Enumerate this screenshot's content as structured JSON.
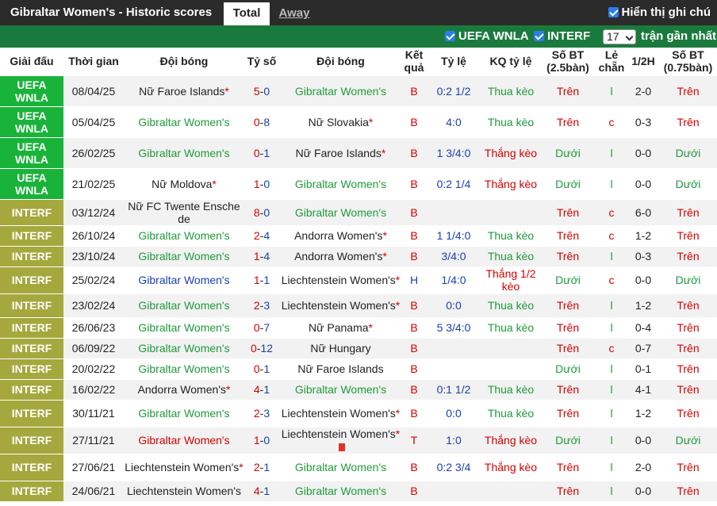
{
  "header": {
    "title": "Gibraltar Women's - Historic scores",
    "tabs": [
      "Total",
      "Away"
    ],
    "show_notes_label": "Hiển thị ghi chú"
  },
  "filters": {
    "uefa_label": "UEFA WNLA",
    "interf_label": "INTERF",
    "recent_count": "17",
    "recent_label": "trận gần nhất"
  },
  "columns": [
    "Giải đấu",
    "Thời gian",
    "Đội bóng",
    "Tỷ số",
    "Đội bóng",
    "Kết quả",
    "Tỷ lệ",
    "KQ tỷ lệ",
    "Số BT (2.5bàn)",
    "Lẻ chẵn",
    "1/2H",
    "Số BT (0.75bàn)"
  ],
  "colors": {
    "uefa": "#19b33a",
    "interf": "#a5a83c",
    "header_bg": "#2b2b2b",
    "filter_bg": "#1a7a3d"
  },
  "rows": [
    {
      "league": "UEFA WNLA",
      "date": "08/04/25",
      "home": "Nữ Faroe Islands",
      "home_star": "*",
      "home_color": "",
      "score_h": "5",
      "score_a": "0",
      "away": "Gibraltar Women's",
      "away_star": "",
      "away_color": "green",
      "result": "B",
      "odds": "0:2 1/2",
      "odds_res": "Thua kèo",
      "bt25": "Trên",
      "le": "l",
      "h1": "2-0",
      "bt075": "Trên"
    },
    {
      "league": "UEFA WNLA",
      "date": "05/04/25",
      "home": "Gibraltar Women's",
      "home_star": "",
      "home_color": "green",
      "score_h": "0",
      "score_a": "8",
      "away": "Nữ Slovakia",
      "away_star": "*",
      "away_color": "",
      "result": "B",
      "odds": "4:0",
      "odds_res": "Thua kèo",
      "bt25": "Trên",
      "le": "c",
      "h1": "0-3",
      "bt075": "Trên"
    },
    {
      "league": "UEFA WNLA",
      "date": "26/02/25",
      "home": "Gibraltar Women's",
      "home_star": "",
      "home_color": "green",
      "score_h": "0",
      "score_a": "1",
      "away": "Nữ Faroe Islands",
      "away_star": "*",
      "away_color": "",
      "result": "B",
      "odds": "1 3/4:0",
      "odds_res": "Thắng kèo",
      "bt25": "Dưới",
      "le": "l",
      "h1": "0-0",
      "bt075": "Dưới"
    },
    {
      "league": "UEFA WNLA",
      "date": "21/02/25",
      "home": "Nữ Moldova",
      "home_star": "*",
      "home_color": "",
      "score_h": "1",
      "score_a": "0",
      "away": "Gibraltar Women's",
      "away_star": "",
      "away_color": "green",
      "result": "B",
      "odds": "0:2 1/4",
      "odds_res": "Thắng kèo",
      "bt25": "Dưới",
      "le": "l",
      "h1": "0-0",
      "bt075": "Dưới"
    },
    {
      "league": "INTERF",
      "date": "03/12/24",
      "home": "Nữ FC Twente Ensche de",
      "home_star": "",
      "home_color": "",
      "score_h": "8",
      "score_a": "0",
      "away": "Gibraltar Women's",
      "away_star": "",
      "away_color": "green",
      "result": "B",
      "odds": "",
      "odds_res": "",
      "bt25": "Trên",
      "le": "c",
      "h1": "6-0",
      "bt075": "Trên"
    },
    {
      "league": "INTERF",
      "date": "26/10/24",
      "home": "Gibraltar Women's",
      "home_star": "",
      "home_color": "green",
      "score_h": "2",
      "score_a": "4",
      "away": "Andorra Women's",
      "away_star": "*",
      "away_color": "",
      "result": "B",
      "odds": "1 1/4:0",
      "odds_res": "Thua kèo",
      "bt25": "Trên",
      "le": "c",
      "h1": "1-2",
      "bt075": "Trên"
    },
    {
      "league": "INTERF",
      "date": "23/10/24",
      "home": "Gibraltar Women's",
      "home_star": "",
      "home_color": "green",
      "score_h": "1",
      "score_a": "4",
      "away": "Andorra Women's",
      "away_star": "*",
      "away_color": "",
      "result": "B",
      "odds": "3/4:0",
      "odds_res": "Thua kèo",
      "bt25": "Trên",
      "le": "l",
      "h1": "0-3",
      "bt075": "Trên"
    },
    {
      "league": "INTERF",
      "date": "25/02/24",
      "home": "Gibraltar Women's",
      "home_star": "",
      "home_color": "blue",
      "score_h": "1",
      "score_a": "1",
      "away": "Liechtenstein Women's",
      "away_star": "*",
      "away_color": "",
      "result": "H",
      "odds": "1/4:0",
      "odds_res": "Thắng 1/2 kèo",
      "bt25": "Dưới",
      "le": "c",
      "h1": "0-0",
      "bt075": "Dưới"
    },
    {
      "league": "INTERF",
      "date": "23/02/24",
      "home": "Gibraltar Women's",
      "home_star": "",
      "home_color": "green",
      "score_h": "2",
      "score_a": "3",
      "away": "Liechtenstein Women's",
      "away_star": "*",
      "away_color": "",
      "result": "B",
      "odds": "0:0",
      "odds_res": "Thua kèo",
      "bt25": "Trên",
      "le": "l",
      "h1": "1-2",
      "bt075": "Trên"
    },
    {
      "league": "INTERF",
      "date": "26/06/23",
      "home": "Gibraltar Women's",
      "home_star": "",
      "home_color": "green",
      "score_h": "0",
      "score_a": "7",
      "away": "Nữ Panama",
      "away_star": "*",
      "away_color": "",
      "result": "B",
      "odds": "5 3/4:0",
      "odds_res": "Thua kèo",
      "bt25": "Trên",
      "le": "l",
      "h1": "0-4",
      "bt075": "Trên"
    },
    {
      "league": "INTERF",
      "date": "06/09/22",
      "home": "Gibraltar Women's",
      "home_star": "",
      "home_color": "green",
      "score_h": "0",
      "score_a": "12",
      "away": "Nữ Hungary",
      "away_star": "",
      "away_color": "",
      "result": "B",
      "odds": "",
      "odds_res": "",
      "bt25": "Trên",
      "le": "c",
      "h1": "0-7",
      "bt075": "Trên"
    },
    {
      "league": "INTERF",
      "date": "20/02/22",
      "home": "Gibraltar Women's",
      "home_star": "",
      "home_color": "green",
      "score_h": "0",
      "score_a": "1",
      "away": "Nữ Faroe Islands",
      "away_star": "",
      "away_color": "",
      "result": "B",
      "odds": "",
      "odds_res": "",
      "bt25": "Dưới",
      "le": "l",
      "h1": "0-1",
      "bt075": "Trên"
    },
    {
      "league": "INTERF",
      "date": "16/02/22",
      "home": "Andorra Women's",
      "home_star": "*",
      "home_color": "",
      "score_h": "4",
      "score_a": "1",
      "away": "Gibraltar Women's",
      "away_star": "",
      "away_color": "green",
      "result": "B",
      "odds": "0:1 1/2",
      "odds_res": "Thua kèo",
      "bt25": "Trên",
      "le": "l",
      "h1": "4-1",
      "bt075": "Trên"
    },
    {
      "league": "INTERF",
      "date": "30/11/21",
      "home": "Gibraltar Women's",
      "home_star": "",
      "home_color": "green",
      "score_h": "2",
      "score_a": "3",
      "away": "Liechtenstein Women's",
      "away_star": "*",
      "away_color": "",
      "result": "B",
      "odds": "0:0",
      "odds_res": "Thua kèo",
      "bt25": "Trên",
      "le": "l",
      "h1": "1-2",
      "bt075": "Trên"
    },
    {
      "league": "INTERF",
      "date": "27/11/21",
      "home": "Gibraltar Women's",
      "home_star": "",
      "home_color": "red",
      "score_h": "1",
      "score_a": "0",
      "away": "Liechtenstein Women's",
      "away_star": "*",
      "away_color": "",
      "away_card": true,
      "result": "T",
      "odds": "1:0",
      "odds_res": "Thắng kèo",
      "bt25": "Dưới",
      "le": "l",
      "h1": "0-0",
      "bt075": "Dưới"
    },
    {
      "league": "INTERF",
      "date": "27/06/21",
      "home": "Liechtenstein Women's",
      "home_star": "*",
      "home_color": "",
      "score_h": "2",
      "score_a": "1",
      "away": "Gibraltar Women's",
      "away_star": "",
      "away_color": "green",
      "result": "B",
      "odds": "0:2 3/4",
      "odds_res": "Thắng kèo",
      "bt25": "Trên",
      "le": "l",
      "h1": "2-0",
      "bt075": "Trên"
    },
    {
      "league": "INTERF",
      "date": "24/06/21",
      "home": "Liechtenstein Women's",
      "home_star": "",
      "home_color": "",
      "score_h": "4",
      "score_a": "1",
      "away": "Gibraltar Women's",
      "away_star": "",
      "away_color": "green",
      "result": "B",
      "odds": "",
      "odds_res": "",
      "bt25": "Trên",
      "le": "l",
      "h1": "0-0",
      "bt075": "Trên"
    }
  ]
}
